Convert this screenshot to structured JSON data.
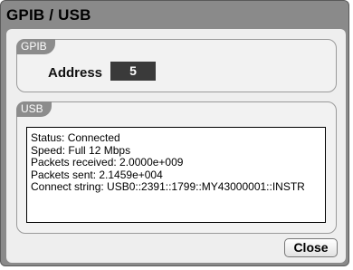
{
  "dialog": {
    "title": "GPIB / USB"
  },
  "gpib": {
    "group_label": "GPIB",
    "address_label": "Address",
    "address_value": "5"
  },
  "usb": {
    "group_label": "USB",
    "status": "Status: Connected",
    "speed": "Speed: Full 12 Mbps",
    "packets_received": "Packets received: 2.0000e+009",
    "packets_sent": "Packets sent: 2.1459e+004",
    "connect_string": "Connect string: USB0::2391::1799::MY43000001::INSTR"
  },
  "buttons": {
    "close_label": "Close"
  }
}
